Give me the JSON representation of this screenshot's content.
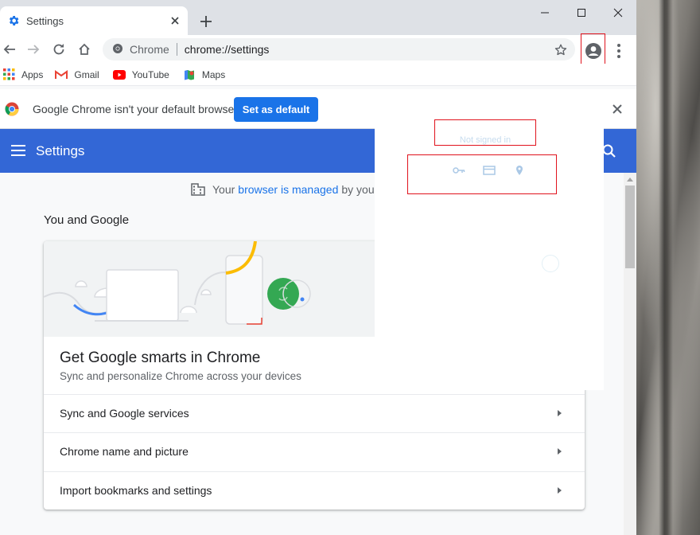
{
  "window": {
    "tab_title": "Settings",
    "url_chip": "Chrome",
    "url": "chrome://settings"
  },
  "bookmarks": [
    {
      "label": "Apps",
      "icon": "apps-grid-icon"
    },
    {
      "label": "Gmail",
      "icon": "gmail-icon"
    },
    {
      "label": "YouTube",
      "icon": "youtube-icon"
    },
    {
      "label": "Maps",
      "icon": "maps-icon"
    }
  ],
  "infobar": {
    "message": "Google Chrome isn't your default browser",
    "button": "Set as default"
  },
  "header": {
    "title": "Settings"
  },
  "managed": {
    "prefix": "Your",
    "link": "browser is managed",
    "suffix": "by your"
  },
  "section": {
    "title": "You and Google"
  },
  "card": {
    "title": "Get Google smarts in Chrome",
    "subtitle": "Sync and personalize Chrome across your devices",
    "rows": [
      {
        "label": "Sync and Google services"
      },
      {
        "label": "Chrome name and picture"
      },
      {
        "label": "Import bookmarks and settings"
      }
    ]
  },
  "popup": {
    "status": "Not signed in",
    "actions": [
      "key-icon",
      "credit-card-icon",
      "location-pin-icon"
    ]
  },
  "colors": {
    "accent": "#1a73e8",
    "header": "#3367d6",
    "highlight_outline": "#e0131d"
  }
}
